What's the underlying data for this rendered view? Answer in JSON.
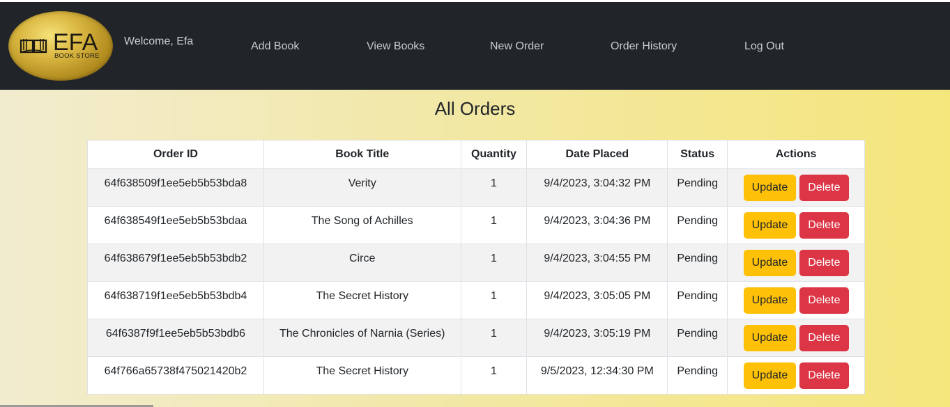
{
  "brand": {
    "logo_title": "EFA",
    "logo_subtitle": "BOOK STORE",
    "logo_icon": "book-icon"
  },
  "header": {
    "welcome": "Welcome, Efa",
    "nav": [
      {
        "label": "Add Book"
      },
      {
        "label": "View Books"
      },
      {
        "label": "New Order"
      },
      {
        "label": "Order History"
      },
      {
        "label": "Log Out"
      }
    ]
  },
  "main": {
    "title": "All Orders",
    "columns": [
      "Order ID",
      "Book Title",
      "Quantity",
      "Date Placed",
      "Status",
      "Actions"
    ],
    "update_label": "Update",
    "delete_label": "Delete",
    "orders": [
      {
        "id": "64f638509f1ee5eb5b53bda8",
        "title": "Verity",
        "quantity": "1",
        "date": "9/4/2023, 3:04:32 PM",
        "status": "Pending"
      },
      {
        "id": "64f638549f1ee5eb5b53bdaa",
        "title": "The Song of Achilles",
        "quantity": "1",
        "date": "9/4/2023, 3:04:36 PM",
        "status": "Pending"
      },
      {
        "id": "64f638679f1ee5eb5b53bdb2",
        "title": "Circe",
        "quantity": "1",
        "date": "9/4/2023, 3:04:55 PM",
        "status": "Pending"
      },
      {
        "id": "64f638719f1ee5eb5b53bdb4",
        "title": "The Secret History",
        "quantity": "1",
        "date": "9/4/2023, 3:05:05 PM",
        "status": "Pending"
      },
      {
        "id": "64f6387f9f1ee5eb5b53bdb6",
        "title": "The Chronicles of Narnia (Series)",
        "quantity": "1",
        "date": "9/4/2023, 3:05:19 PM",
        "status": "Pending"
      },
      {
        "id": "64f766a65738f475021420b2",
        "title": "The Secret History",
        "quantity": "1",
        "date": "9/5/2023, 12:34:30 PM",
        "status": "Pending"
      }
    ]
  },
  "colors": {
    "navbar": "#212529",
    "update_button": "#ffc107",
    "delete_button": "#dc3545"
  }
}
